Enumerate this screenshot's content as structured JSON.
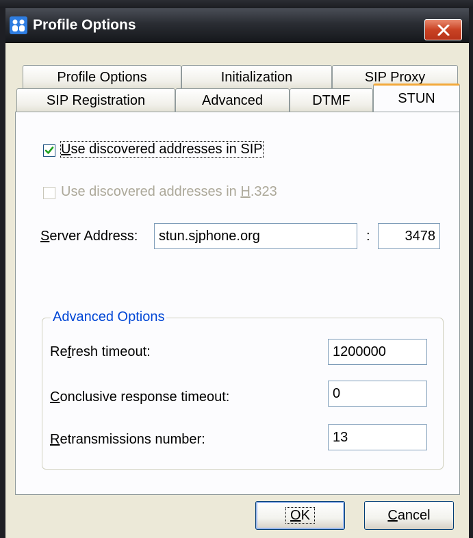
{
  "window": {
    "title": "Profile Options"
  },
  "tabs": {
    "row1": [
      "Profile Options",
      "Initialization",
      "SIP Proxy"
    ],
    "row2": [
      "SIP Registration",
      "Advanced",
      "DTMF",
      "STUN"
    ],
    "active": "STUN"
  },
  "stun": {
    "use_sip": {
      "checked": true,
      "pre": "",
      "mnemonic": "U",
      "post": "se discovered addresses in SIP"
    },
    "use_h323": {
      "checked": false,
      "disabled": true,
      "pre": "Use discovered addresses in ",
      "mnemonic": "H",
      "post": ".323"
    },
    "server": {
      "label_mnemonic": "S",
      "label_rest": "erver Address:",
      "address": "stun.sjphone.org",
      "separator": ":",
      "port": "3478"
    }
  },
  "advanced": {
    "title": "Advanced Options",
    "refresh": {
      "pre": "Re",
      "mnemonic": "f",
      "post": "resh timeout:",
      "value": "1200000"
    },
    "conclusive": {
      "pre": "",
      "mnemonic": "C",
      "post": "onclusive response timeout:",
      "value": "0"
    },
    "retransmissions": {
      "pre": "",
      "mnemonic": "R",
      "post": "etransmissions number:",
      "value": "13"
    }
  },
  "buttons": {
    "ok": {
      "mnemonic": "O",
      "rest": "K"
    },
    "cancel": {
      "mnemonic": "C",
      "rest": "ancel"
    }
  },
  "icons": {
    "app": "profile-people-icon",
    "close": "close-x-icon",
    "check": "checkmark-icon"
  },
  "colors": {
    "accent_tab": "#f3a93a",
    "group_title": "#0046d5",
    "close_button": "#c94224"
  }
}
